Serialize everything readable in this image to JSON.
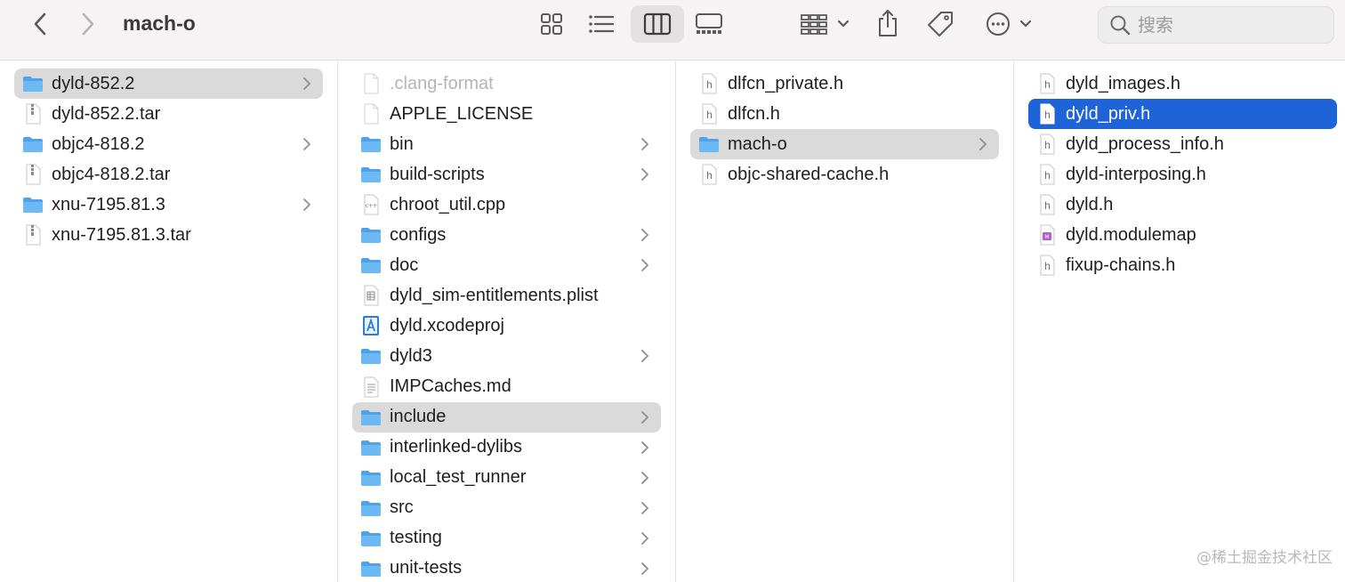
{
  "toolbar": {
    "title": "mach-o",
    "search_placeholder": "搜索"
  },
  "columns": [
    {
      "name": "column-1",
      "items": [
        {
          "label": "dyld-852.2",
          "icon": "folder-icon",
          "chevron": true,
          "state": "path"
        },
        {
          "label": "dyld-852.2.tar",
          "icon": "archive-icon",
          "chevron": false,
          "state": "none"
        },
        {
          "label": "objc4-818.2",
          "icon": "folder-icon",
          "chevron": true,
          "state": "none"
        },
        {
          "label": "objc4-818.2.tar",
          "icon": "archive-icon",
          "chevron": false,
          "state": "none"
        },
        {
          "label": "xnu-7195.81.3",
          "icon": "folder-icon",
          "chevron": true,
          "state": "none"
        },
        {
          "label": "xnu-7195.81.3.tar",
          "icon": "archive-icon",
          "chevron": false,
          "state": "none"
        }
      ]
    },
    {
      "name": "column-2",
      "items": [
        {
          "label": ".clang-format",
          "icon": "file-icon",
          "chevron": false,
          "state": "dim"
        },
        {
          "label": "APPLE_LICENSE",
          "icon": "file-icon",
          "chevron": false,
          "state": "none"
        },
        {
          "label": "bin",
          "icon": "folder-icon",
          "chevron": true,
          "state": "none"
        },
        {
          "label": "build-scripts",
          "icon": "folder-icon",
          "chevron": true,
          "state": "none"
        },
        {
          "label": "chroot_util.cpp",
          "icon": "cpp-file-icon",
          "chevron": false,
          "state": "none"
        },
        {
          "label": "configs",
          "icon": "folder-icon",
          "chevron": true,
          "state": "none"
        },
        {
          "label": "doc",
          "icon": "folder-icon",
          "chevron": true,
          "state": "none"
        },
        {
          "label": "dyld_sim-entitlements.plist",
          "icon": "plist-icon",
          "chevron": false,
          "state": "none"
        },
        {
          "label": "dyld.xcodeproj",
          "icon": "xcodeproj-icon",
          "chevron": false,
          "state": "none"
        },
        {
          "label": "dyld3",
          "icon": "folder-icon",
          "chevron": true,
          "state": "none"
        },
        {
          "label": "IMPCaches.md",
          "icon": "text-file-icon",
          "chevron": false,
          "state": "none"
        },
        {
          "label": "include",
          "icon": "folder-icon",
          "chevron": true,
          "state": "path"
        },
        {
          "label": "interlinked-dylibs",
          "icon": "folder-icon",
          "chevron": true,
          "state": "none"
        },
        {
          "label": "local_test_runner",
          "icon": "folder-icon",
          "chevron": true,
          "state": "none"
        },
        {
          "label": "src",
          "icon": "folder-icon",
          "chevron": true,
          "state": "none"
        },
        {
          "label": "testing",
          "icon": "folder-icon",
          "chevron": true,
          "state": "none"
        },
        {
          "label": "unit-tests",
          "icon": "folder-icon",
          "chevron": true,
          "state": "none"
        }
      ]
    },
    {
      "name": "column-3",
      "items": [
        {
          "label": "dlfcn_private.h",
          "icon": "header-file-icon",
          "chevron": false,
          "state": "none"
        },
        {
          "label": "dlfcn.h",
          "icon": "header-file-icon",
          "chevron": false,
          "state": "none"
        },
        {
          "label": "mach-o",
          "icon": "folder-icon",
          "chevron": true,
          "state": "path"
        },
        {
          "label": "objc-shared-cache.h",
          "icon": "header-file-icon",
          "chevron": false,
          "state": "none"
        }
      ]
    },
    {
      "name": "column-4",
      "items": [
        {
          "label": "dyld_images.h",
          "icon": "header-file-icon",
          "chevron": false,
          "state": "none"
        },
        {
          "label": "dyld_priv.h",
          "icon": "header-file-icon",
          "chevron": false,
          "state": "selected"
        },
        {
          "label": "dyld_process_info.h",
          "icon": "header-file-icon",
          "chevron": false,
          "state": "none"
        },
        {
          "label": "dyld-interposing.h",
          "icon": "header-file-icon",
          "chevron": false,
          "state": "none"
        },
        {
          "label": "dyld.h",
          "icon": "header-file-icon",
          "chevron": false,
          "state": "none"
        },
        {
          "label": "dyld.modulemap",
          "icon": "modulemap-icon",
          "chevron": false,
          "state": "none"
        },
        {
          "label": "fixup-chains.h",
          "icon": "header-file-icon",
          "chevron": false,
          "state": "none"
        }
      ]
    }
  ],
  "watermark": "@稀土掘金技术社区",
  "colors": {
    "selection_blue": "#1f63d8",
    "path_gray": "#dadada",
    "folder_blue": "#58aef0"
  }
}
